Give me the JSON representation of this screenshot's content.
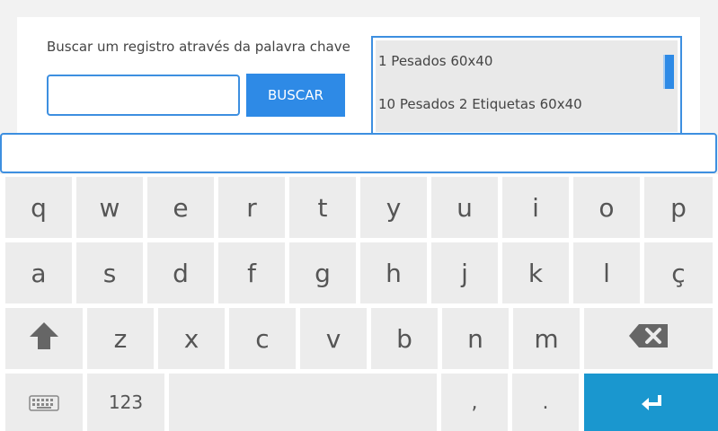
{
  "search": {
    "label": "Buscar um registro através da palavra chave",
    "input_value": "",
    "button_label": "BUSCAR"
  },
  "results": {
    "items": [
      {
        "label": "1 Pesados 60x40"
      },
      {
        "label": "10 Pesados 2 Etiquetas 60x40"
      }
    ]
  },
  "text_field": {
    "value": ""
  },
  "keyboard": {
    "row1": [
      "q",
      "w",
      "e",
      "r",
      "t",
      "y",
      "u",
      "i",
      "o",
      "p"
    ],
    "row2": [
      "a",
      "s",
      "d",
      "f",
      "g",
      "h",
      "j",
      "k",
      "l",
      "ç"
    ],
    "row3": [
      "z",
      "x",
      "c",
      "v",
      "b",
      "n",
      "m"
    ],
    "numbers_key": "123",
    "comma_key": ",",
    "period_key": ".",
    "shift_icon": "shift-arrow-icon",
    "backspace_icon": "backspace-icon",
    "keyboard_icon": "keyboard-icon",
    "enter_icon": "enter-arrow-icon",
    "enter_color": "#1a97cf"
  },
  "colors": {
    "accent": "#2e8ae6",
    "key_bg": "#ececec"
  }
}
